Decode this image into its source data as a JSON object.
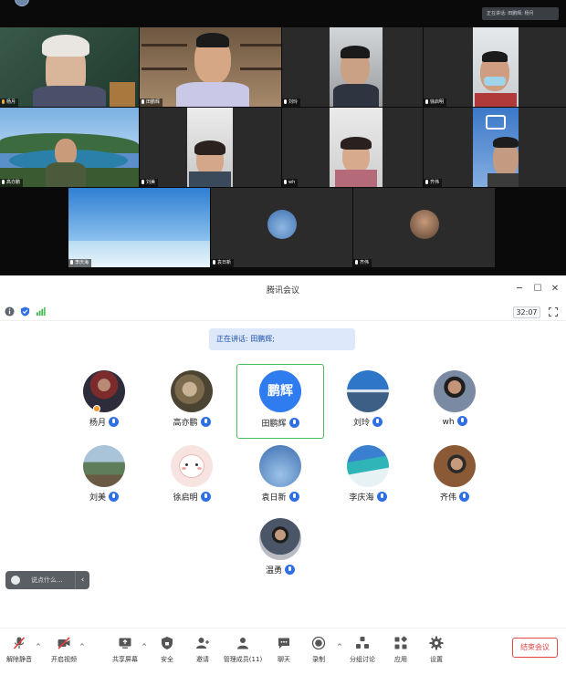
{
  "gallery": {
    "top_bar_text": "正在讲话: 田鹏辉; 杨月",
    "tiles": [
      {
        "name": "杨月",
        "mic": "hand"
      },
      {
        "name": "田鹏辉",
        "mic": "on"
      },
      {
        "name": "刘玲",
        "mic": "on"
      },
      {
        "name": "徐启明",
        "mic": "on"
      },
      {
        "name": "高亦鹏",
        "mic": "on"
      },
      {
        "name": "刘美",
        "mic": "on"
      },
      {
        "name": "wh",
        "mic": "on"
      },
      {
        "name": "齐伟",
        "mic": "on"
      },
      {
        "name": "李庆海",
        "mic": "on"
      },
      {
        "name": "袁日新",
        "mic": "on"
      },
      {
        "name": "齐伟",
        "mic": "on"
      }
    ]
  },
  "window": {
    "title": "腾讯会议",
    "minimize": "─",
    "maximize": "☐",
    "close": "✕"
  },
  "status": {
    "timer": "32:07"
  },
  "speaking": {
    "text": "正在讲话: 田鹏辉;"
  },
  "participants": [
    {
      "name": "杨月"
    },
    {
      "name": "高亦鹏"
    },
    {
      "name": "田鹏辉",
      "avatar_text": "鹏辉"
    },
    {
      "name": "刘玲"
    },
    {
      "name": "wh"
    },
    {
      "name": "刘美"
    },
    {
      "name": "徐启明"
    },
    {
      "name": "袁日新"
    },
    {
      "name": "李庆海"
    },
    {
      "name": "齐伟"
    },
    {
      "name": "温勇"
    }
  ],
  "chat": {
    "placeholder": "说点什么...",
    "collapse": "‹"
  },
  "toolbar": {
    "unmute": "解除静音",
    "start_video": "开启视频",
    "share_screen": "共享屏幕",
    "security": "安全",
    "invite": "邀请",
    "manage_members": "管理成员(11)",
    "chat": "聊天",
    "record": "录制",
    "breakout": "分组讨论",
    "apps": "应用",
    "settings": "设置",
    "end_meeting": "结束会议",
    "caret": "^"
  },
  "colors": {
    "accent_blue": "#2f6fe4",
    "active_green": "#4bbd62",
    "end_red": "#e64545",
    "mute_red": "#e03c3c"
  }
}
